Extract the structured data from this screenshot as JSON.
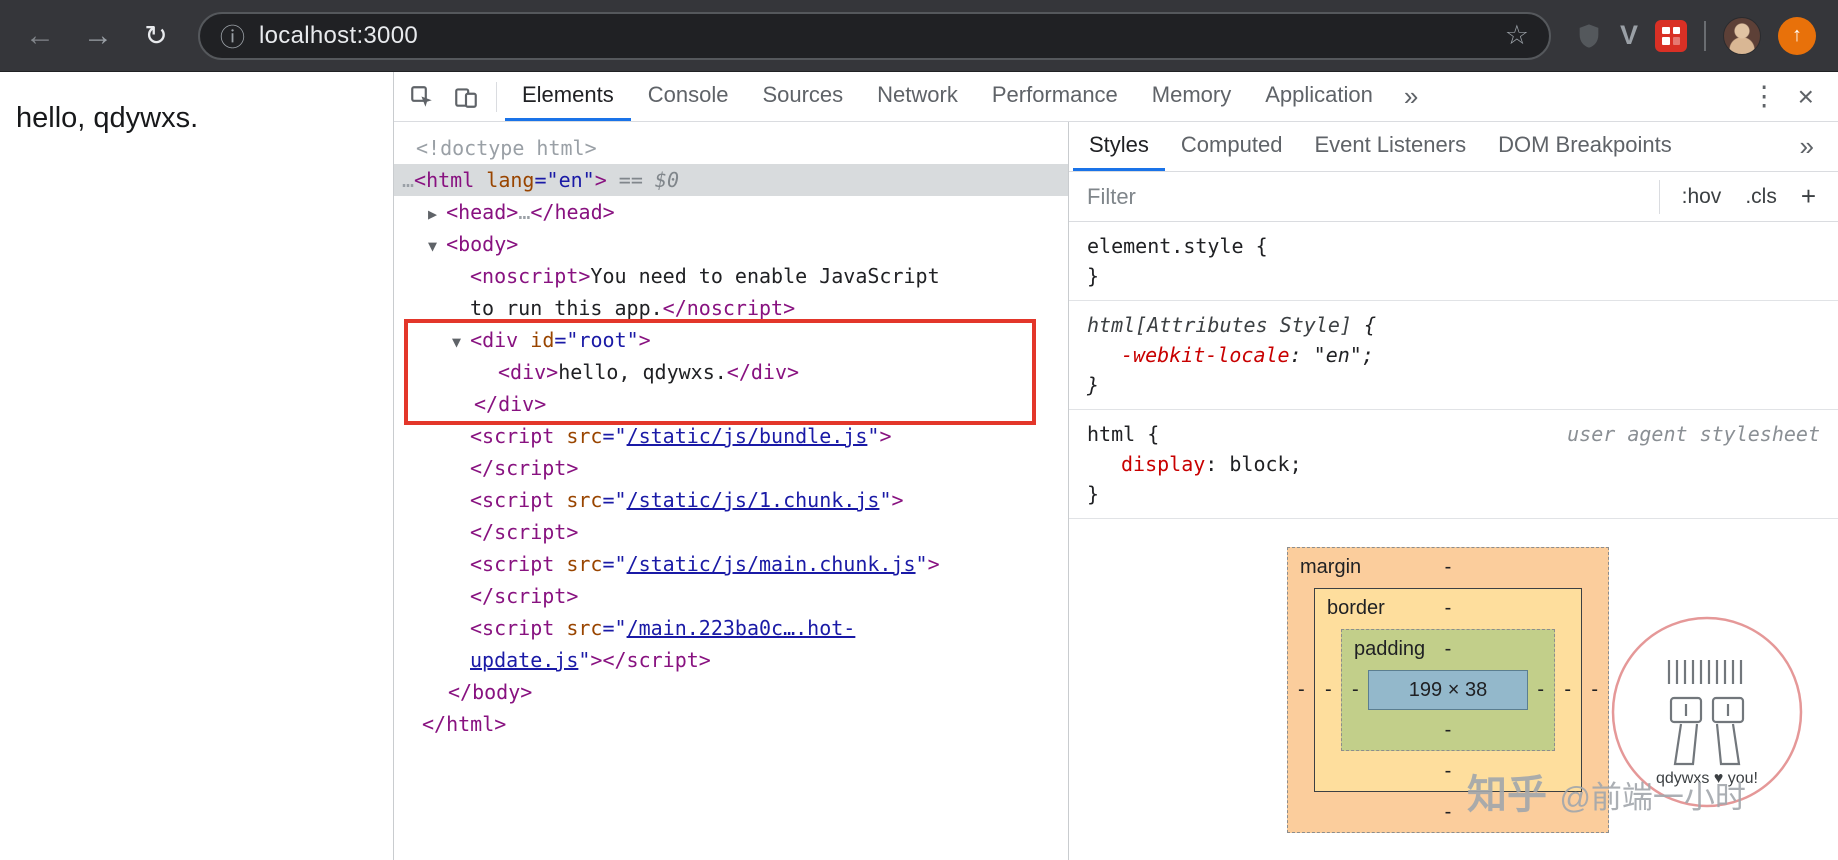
{
  "colors": {
    "accent_blue": "#1a73e8",
    "annotation_red": "#e3362a",
    "selection_gray": "#d8dbdd",
    "box_margin": "#fbcd9c",
    "box_border": "#fede9d",
    "box_padding": "#c2cf8a",
    "box_content": "#93b8cb"
  },
  "browser": {
    "url": "localhost:3000",
    "icons": {
      "back": "←",
      "forward": "→",
      "reload": "↻",
      "site_info": "ⓘ",
      "bookmark_star": "☆",
      "extension_v": "V",
      "update_arrow": "↑"
    }
  },
  "page": {
    "greeting": "hello, qdywxs."
  },
  "devtools": {
    "toolbar": {
      "tabs": [
        "Elements",
        "Console",
        "Sources",
        "Network",
        "Performance",
        "Memory",
        "Application"
      ],
      "active_tab": "Elements",
      "more_icon": "»",
      "kebab_icon": "⋮",
      "close_icon": "×"
    },
    "elements": {
      "rows": [
        {
          "indent": 22,
          "segments": [
            {
              "c": "g",
              "t": "<!doctype html>"
            }
          ]
        },
        {
          "indent": 8,
          "selected": true,
          "segments": [
            {
              "c": "g",
              "t": "…"
            },
            {
              "c": "t",
              "t": "<html"
            },
            {
              "c": "a",
              "t": " lang"
            },
            {
              "c": "v",
              "t": "=\"en\""
            },
            {
              "c": "t",
              "t": ">"
            },
            {
              "c": "f",
              "t": " == $0"
            }
          ]
        },
        {
          "indent": 34,
          "segments": [
            {
              "c": "r",
              "t": "▶ "
            },
            {
              "c": "t",
              "t": "<head>"
            },
            {
              "c": "g",
              "t": "…"
            },
            {
              "c": "t",
              "t": "</head>"
            }
          ]
        },
        {
          "indent": 34,
          "segments": [
            {
              "c": "r",
              "t": "▼ "
            },
            {
              "c": "t",
              "t": "<body>"
            }
          ]
        },
        {
          "indent": 76,
          "segments": [
            {
              "c": "t",
              "t": "<noscript>"
            },
            {
              "c": "x",
              "t": "You need to enable JavaScript"
            }
          ]
        },
        {
          "indent": 76,
          "segments": [
            {
              "c": "x",
              "t": "to run this app."
            },
            {
              "c": "t",
              "t": "</noscript>"
            }
          ]
        },
        {
          "indent": 58,
          "segments": [
            {
              "c": "r",
              "t": "▼ "
            },
            {
              "c": "t",
              "t": "<div"
            },
            {
              "c": "a",
              "t": " id"
            },
            {
              "c": "v",
              "t": "=\"root\""
            },
            {
              "c": "t",
              "t": ">"
            }
          ]
        },
        {
          "indent": 104,
          "segments": [
            {
              "c": "t",
              "t": "<div>"
            },
            {
              "c": "x",
              "t": "hello, qdywxs."
            },
            {
              "c": "t",
              "t": "</div>"
            }
          ]
        },
        {
          "indent": 80,
          "segments": [
            {
              "c": "t",
              "t": "</div>"
            }
          ]
        },
        {
          "indent": 76,
          "segments": [
            {
              "c": "t",
              "t": "<script"
            },
            {
              "c": "a",
              "t": " src"
            },
            {
              "c": "v",
              "t": "=\""
            },
            {
              "c": "l",
              "t": "/static/js/bundle.js"
            },
            {
              "c": "v",
              "t": "\""
            },
            {
              "c": "t",
              "t": ">"
            }
          ]
        },
        {
          "indent": 76,
          "segments": [
            {
              "c": "t",
              "t": "</script>"
            }
          ]
        },
        {
          "indent": 76,
          "segments": [
            {
              "c": "t",
              "t": "<script"
            },
            {
              "c": "a",
              "t": " src"
            },
            {
              "c": "v",
              "t": "=\""
            },
            {
              "c": "l",
              "t": "/static/js/1.chunk.js"
            },
            {
              "c": "v",
              "t": "\""
            },
            {
              "c": "t",
              "t": ">"
            }
          ]
        },
        {
          "indent": 76,
          "segments": [
            {
              "c": "t",
              "t": "</script>"
            }
          ]
        },
        {
          "indent": 76,
          "segments": [
            {
              "c": "t",
              "t": "<script"
            },
            {
              "c": "a",
              "t": " src"
            },
            {
              "c": "v",
              "t": "=\""
            },
            {
              "c": "l",
              "t": "/static/js/main.chunk.js"
            },
            {
              "c": "v",
              "t": "\""
            },
            {
              "c": "t",
              "t": ">"
            }
          ]
        },
        {
          "indent": 76,
          "segments": [
            {
              "c": "t",
              "t": "</script>"
            }
          ]
        },
        {
          "indent": 76,
          "segments": [
            {
              "c": "t",
              "t": "<script"
            },
            {
              "c": "a",
              "t": " src"
            },
            {
              "c": "v",
              "t": "=\""
            },
            {
              "c": "l",
              "t": "/main.223ba0c….hot-"
            }
          ]
        },
        {
          "indent": 76,
          "segments": [
            {
              "c": "l",
              "t": "update.js"
            },
            {
              "c": "v",
              "t": "\""
            },
            {
              "c": "t",
              "t": "></script>"
            }
          ]
        },
        {
          "indent": 54,
          "segments": [
            {
              "c": "t",
              "t": "</body>"
            }
          ]
        },
        {
          "indent": 28,
          "segments": [
            {
              "c": "t",
              "t": "</html>"
            }
          ]
        }
      ]
    },
    "styles": {
      "tabs": [
        "Styles",
        "Computed",
        "Event Listeners",
        "DOM Breakpoints"
      ],
      "active_tab": "Styles",
      "more_icon": "»",
      "filter_placeholder": "Filter",
      "pseudo_toggle": ":hov",
      "class_toggle": ".cls",
      "add_rule": "+",
      "rules": [
        {
          "selector": "element.style",
          "declarations": []
        },
        {
          "selector": "html[Attributes Style]",
          "italic": true,
          "declarations": [
            {
              "prop": "-webkit-locale",
              "value": "\"en\""
            }
          ]
        },
        {
          "selector": "html",
          "note": "user agent stylesheet",
          "declarations": [
            {
              "prop": "display",
              "value": "block"
            }
          ]
        }
      ],
      "box_model": {
        "margin_label": "margin",
        "border_label": "border",
        "padding_label": "padding",
        "content_size": "199 × 38",
        "dash": "-"
      }
    },
    "watermark": {
      "brand": "知乎",
      "handle": "@前端一小时",
      "stamp_text": "qdywxs ♥ you!"
    }
  }
}
